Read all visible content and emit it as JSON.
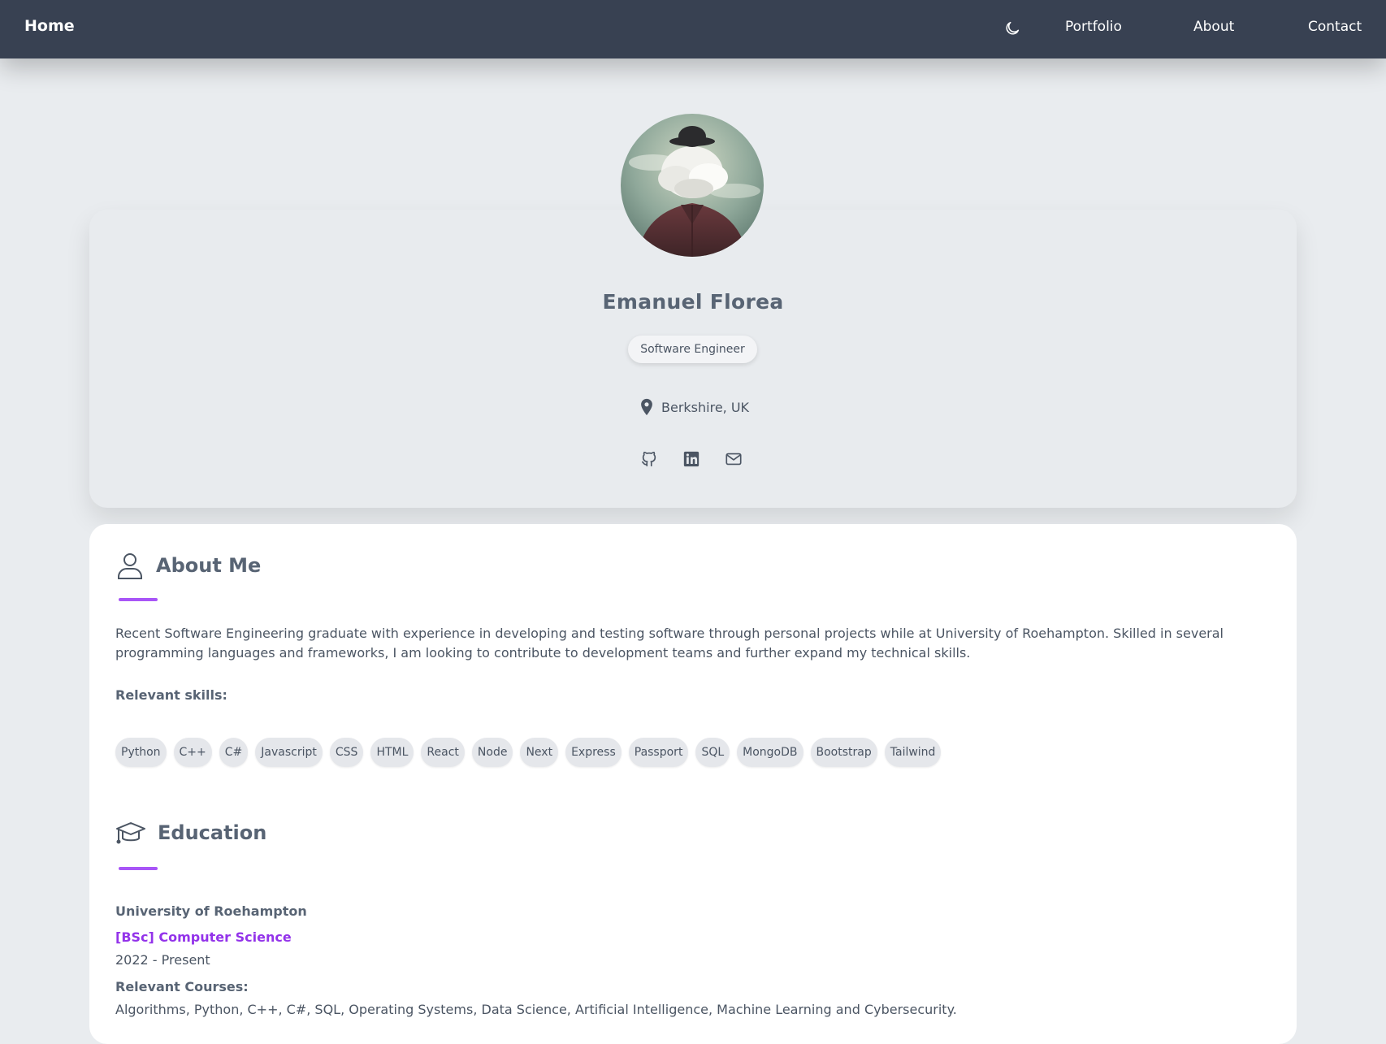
{
  "nav": {
    "brand": "Home",
    "theme_toggle_icon": "moon-icon",
    "links": [
      "Portfolio",
      "About",
      "Contact"
    ]
  },
  "profile": {
    "avatar_alt": "avatar",
    "name": "Emanuel Florea",
    "role": "Software Engineer",
    "location": "Berkshire, UK",
    "socials": [
      "github-icon",
      "linkedin-icon",
      "email-icon"
    ]
  },
  "about": {
    "heading": "About Me",
    "icon": "user-icon",
    "text": "Recent Software Engineering graduate with experience in developing and testing software through personal projects while at University of Roehampton. Skilled in several programming languages and frameworks, I am looking to contribute to development teams and further expand my technical skills.",
    "skills_label": "Relevant skills:",
    "skills": [
      "Python",
      "C++",
      "C#",
      "Javascript",
      "CSS",
      "HTML",
      "React",
      "Node",
      "Next",
      "Express",
      "Passport",
      "SQL",
      "MongoDB",
      "Bootstrap",
      "Tailwind"
    ]
  },
  "education": {
    "heading": "Education",
    "icon": "graduation-cap-icon",
    "school": "University of Roehampton",
    "degree": "[BSc] Computer Science",
    "dates": "2022 - Present",
    "courses_label": "Relevant Courses:",
    "courses": "Algorithms, Python, C++, C#, SQL, Operating Systems, Data Science, Artificial Intelligence, Machine Learning and Cybersecurity."
  },
  "colors": {
    "navbar": "#384152",
    "accent": "#a855f7",
    "degree": "#9333ea",
    "page_bg": "#e9ecef"
  }
}
